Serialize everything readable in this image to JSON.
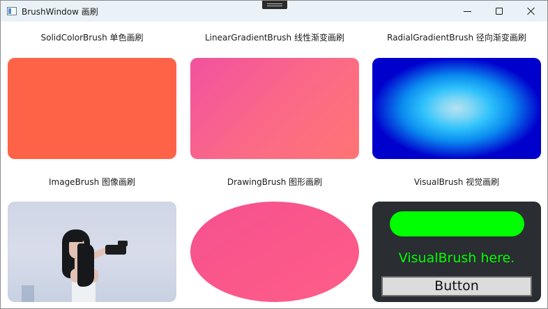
{
  "window": {
    "title": "BrushWindow 画刷",
    "controls": {
      "minimize": "minimize",
      "maximize": "maximize",
      "close": "close"
    }
  },
  "brushes": [
    {
      "label": "SolidColorBrush 单色画刷",
      "color": "#FF6347"
    },
    {
      "label": "LinearGradientBrush 线性渐变画刷",
      "colors": [
        "#F2529E",
        "#FF7474"
      ]
    },
    {
      "label": "RadialGradientBrush 径向渐变画刷",
      "colors": [
        "#B5E2EE",
        "#00BFFF",
        "#0000CD"
      ]
    },
    {
      "label": "ImageBrush 图像画刷"
    },
    {
      "label": "DrawingBrush 图形画刷",
      "colors": [
        "#F5508F",
        "#FF5E87"
      ]
    },
    {
      "label": "VisualBrush 视觉画刷",
      "visual": {
        "text": "VisualBrush here.",
        "button_label": "Button",
        "text_color": "#00FF00"
      }
    }
  ]
}
